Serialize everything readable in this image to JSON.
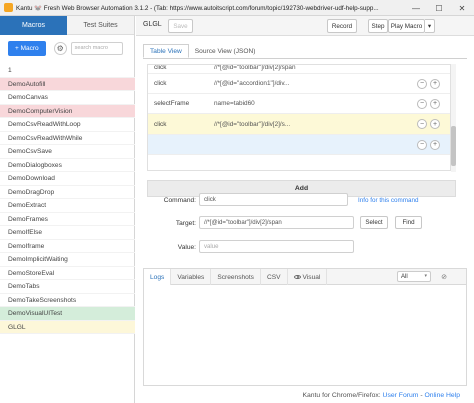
{
  "window": {
    "title": "Kantu 🐭 Fresh Web Browser Automation 3.1.2 - (Tab: https://www.autoitscript.com/forum/topic/192730-webdriver-udf-help-supp...",
    "minimize": "—",
    "maximize": "☐",
    "close": "✕"
  },
  "sidebar": {
    "tabs": [
      "Macros",
      "Test Suites"
    ],
    "new_macro_label": "+ Macro",
    "gear_icon": "⚙",
    "search_placeholder": "search macro",
    "macros": [
      {
        "name": "1",
        "state": "normal"
      },
      {
        "name": "DemoAutofill",
        "state": "error"
      },
      {
        "name": "DemoCanvas",
        "state": "normal"
      },
      {
        "name": "DemoComputerVision",
        "state": "error"
      },
      {
        "name": "DemoCsvReadWithLoop",
        "state": "normal"
      },
      {
        "name": "DemoCsvReadWithWhile",
        "state": "normal"
      },
      {
        "name": "DemoCsvSave",
        "state": "normal"
      },
      {
        "name": "DemoDialogboxes",
        "state": "normal"
      },
      {
        "name": "DemoDownload",
        "state": "normal"
      },
      {
        "name": "DemoDragDrop",
        "state": "normal"
      },
      {
        "name": "DemoExtract",
        "state": "normal"
      },
      {
        "name": "DemoFrames",
        "state": "normal"
      },
      {
        "name": "DemoIfElse",
        "state": "normal"
      },
      {
        "name": "DemoIframe",
        "state": "normal"
      },
      {
        "name": "DemoImplicitWaiting",
        "state": "normal"
      },
      {
        "name": "DemoStoreEval",
        "state": "normal"
      },
      {
        "name": "DemoTabs",
        "state": "normal"
      },
      {
        "name": "DemoTakeScreenshots",
        "state": "normal"
      },
      {
        "name": "DemoVisualUITest",
        "state": "success"
      },
      {
        "name": "GLGL",
        "state": "selected"
      }
    ]
  },
  "toolbar": {
    "macro_name": "GLGL",
    "save_label": "Save",
    "record_label": "Record",
    "step_label": "Step",
    "play_label": "Play Macro",
    "dropdown_caret": "▾"
  },
  "editor": {
    "tabs": [
      "Table View",
      "Source View (JSON)"
    ],
    "partial_row": {
      "command": "click",
      "target": "//*[@id=\"toolbar\"]/div[2]/span"
    },
    "rows": [
      {
        "command": "click",
        "target": "//*[@id=\"accordion1\"]/div..."
      },
      {
        "command": "selectFrame",
        "target": "name=tabid60"
      },
      {
        "command": "click",
        "target": "//*[@id=\"toolbar\"]/div[2]/s..."
      },
      {
        "command": "",
        "target": ""
      }
    ],
    "minus_glyph": "−",
    "plus_glyph": "+",
    "add_label": "Add"
  },
  "properties": {
    "command_label": "Command:",
    "command_value": "click",
    "info_link": "Info for this command",
    "target_label": "Target:",
    "target_value": "//*[@id=\"toolbar\"]/div[2]/span",
    "select_label": "Select",
    "find_label": "Find",
    "value_label": "Value:",
    "value_placeholder": "value"
  },
  "logs": {
    "tabs": [
      "Logs",
      "Variables",
      "Screenshots",
      "CSV",
      "Visual"
    ],
    "filter_value": "All",
    "clear_icon": "⊘"
  },
  "footer": {
    "prefix": "Kantu for Chrome/Firefox:",
    "user_forum": "User Forum",
    "separator": "-",
    "online_help": "Online Help"
  }
}
